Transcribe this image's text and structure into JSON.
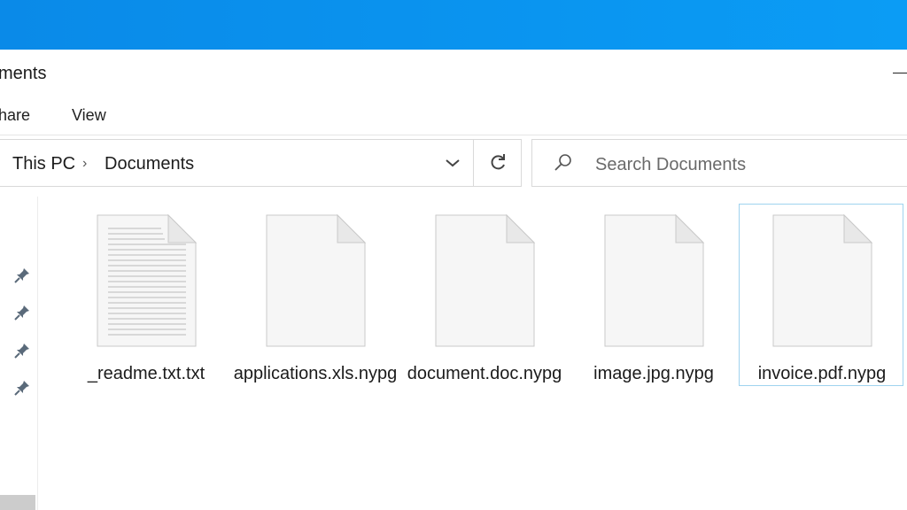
{
  "window": {
    "title": "ments",
    "ribbon": {
      "share_label": "hare",
      "view_label": "View"
    }
  },
  "address": {
    "crumbs": [
      "This PC",
      "Documents"
    ],
    "separator": "›"
  },
  "search": {
    "placeholder": "Search Documents"
  },
  "files": [
    {
      "name": "_readme.txt.txt",
      "icon": "text-document-icon",
      "selected": false
    },
    {
      "name": "applications.xls.nypg",
      "icon": "blank-document-icon",
      "selected": false
    },
    {
      "name": "document.doc.nypg",
      "icon": "blank-document-icon",
      "selected": false
    },
    {
      "name": "image.jpg.nypg",
      "icon": "blank-document-icon",
      "selected": false
    },
    {
      "name": "invoice.pdf.nypg",
      "icon": "blank-document-icon",
      "selected": true
    }
  ],
  "colors": {
    "accent": "#0a95f0",
    "selection_border": "#9fd3ef"
  }
}
